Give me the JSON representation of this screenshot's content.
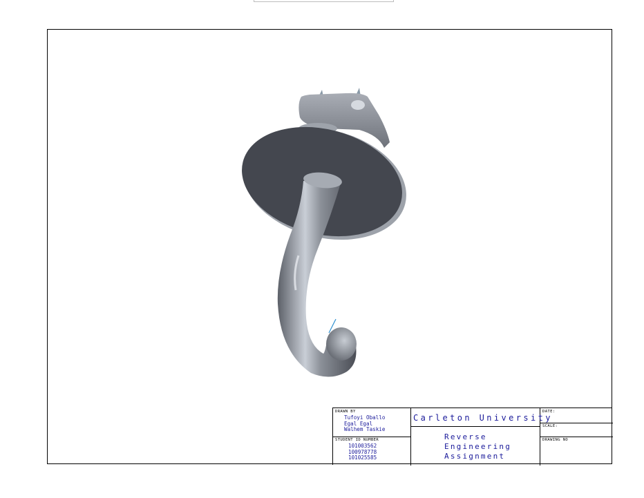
{
  "drawing": {
    "part_description": "3D shaded model of a hook with a round flange and square head"
  },
  "title_block": {
    "drawn_by_label": "DRAWN BY",
    "drawn_by": [
      "Tufoyi Oballo",
      "Egal Egal",
      "Walhem Taskie"
    ],
    "student_id_label": "STUDENT ID NUMBER",
    "student_ids": [
      "101003562",
      "100978778",
      "101025585"
    ],
    "university": "Carleton University",
    "project_lines": [
      "Reverse",
      "Engineering",
      "Assignment"
    ],
    "date_label": "DATE:",
    "scale_label": "SCALE:",
    "drawing_no_label": "DRAWING NO"
  }
}
